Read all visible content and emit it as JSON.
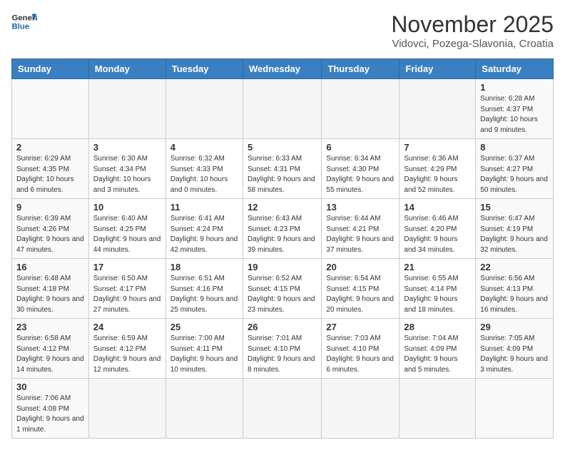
{
  "header": {
    "logo_general": "General",
    "logo_blue": "Blue",
    "month": "November 2025",
    "location": "Vidovci, Pozega-Slavonia, Croatia"
  },
  "days_of_week": [
    "Sunday",
    "Monday",
    "Tuesday",
    "Wednesday",
    "Thursday",
    "Friday",
    "Saturday"
  ],
  "weeks": [
    [
      {
        "day": "",
        "info": ""
      },
      {
        "day": "",
        "info": ""
      },
      {
        "day": "",
        "info": ""
      },
      {
        "day": "",
        "info": ""
      },
      {
        "day": "",
        "info": ""
      },
      {
        "day": "",
        "info": ""
      },
      {
        "day": "1",
        "info": "Sunrise: 6:28 AM\nSunset: 4:37 PM\nDaylight: 10 hours and 9 minutes."
      }
    ],
    [
      {
        "day": "2",
        "info": "Sunrise: 6:29 AM\nSunset: 4:35 PM\nDaylight: 10 hours and 6 minutes."
      },
      {
        "day": "3",
        "info": "Sunrise: 6:30 AM\nSunset: 4:34 PM\nDaylight: 10 hours and 3 minutes."
      },
      {
        "day": "4",
        "info": "Sunrise: 6:32 AM\nSunset: 4:33 PM\nDaylight: 10 hours and 0 minutes."
      },
      {
        "day": "5",
        "info": "Sunrise: 6:33 AM\nSunset: 4:31 PM\nDaylight: 9 hours and 58 minutes."
      },
      {
        "day": "6",
        "info": "Sunrise: 6:34 AM\nSunset: 4:30 PM\nDaylight: 9 hours and 55 minutes."
      },
      {
        "day": "7",
        "info": "Sunrise: 6:36 AM\nSunset: 4:29 PM\nDaylight: 9 hours and 52 minutes."
      },
      {
        "day": "8",
        "info": "Sunrise: 6:37 AM\nSunset: 4:27 PM\nDaylight: 9 hours and 50 minutes."
      }
    ],
    [
      {
        "day": "9",
        "info": "Sunrise: 6:39 AM\nSunset: 4:26 PM\nDaylight: 9 hours and 47 minutes."
      },
      {
        "day": "10",
        "info": "Sunrise: 6:40 AM\nSunset: 4:25 PM\nDaylight: 9 hours and 44 minutes."
      },
      {
        "day": "11",
        "info": "Sunrise: 6:41 AM\nSunset: 4:24 PM\nDaylight: 9 hours and 42 minutes."
      },
      {
        "day": "12",
        "info": "Sunrise: 6:43 AM\nSunset: 4:23 PM\nDaylight: 9 hours and 39 minutes."
      },
      {
        "day": "13",
        "info": "Sunrise: 6:44 AM\nSunset: 4:21 PM\nDaylight: 9 hours and 37 minutes."
      },
      {
        "day": "14",
        "info": "Sunrise: 6:46 AM\nSunset: 4:20 PM\nDaylight: 9 hours and 34 minutes."
      },
      {
        "day": "15",
        "info": "Sunrise: 6:47 AM\nSunset: 4:19 PM\nDaylight: 9 hours and 32 minutes."
      }
    ],
    [
      {
        "day": "16",
        "info": "Sunrise: 6:48 AM\nSunset: 4:18 PM\nDaylight: 9 hours and 30 minutes."
      },
      {
        "day": "17",
        "info": "Sunrise: 6:50 AM\nSunset: 4:17 PM\nDaylight: 9 hours and 27 minutes."
      },
      {
        "day": "18",
        "info": "Sunrise: 6:51 AM\nSunset: 4:16 PM\nDaylight: 9 hours and 25 minutes."
      },
      {
        "day": "19",
        "info": "Sunrise: 6:52 AM\nSunset: 4:15 PM\nDaylight: 9 hours and 23 minutes."
      },
      {
        "day": "20",
        "info": "Sunrise: 6:54 AM\nSunset: 4:15 PM\nDaylight: 9 hours and 20 minutes."
      },
      {
        "day": "21",
        "info": "Sunrise: 6:55 AM\nSunset: 4:14 PM\nDaylight: 9 hours and 18 minutes."
      },
      {
        "day": "22",
        "info": "Sunrise: 6:56 AM\nSunset: 4:13 PM\nDaylight: 9 hours and 16 minutes."
      }
    ],
    [
      {
        "day": "23",
        "info": "Sunrise: 6:58 AM\nSunset: 4:12 PM\nDaylight: 9 hours and 14 minutes."
      },
      {
        "day": "24",
        "info": "Sunrise: 6:59 AM\nSunset: 4:12 PM\nDaylight: 9 hours and 12 minutes."
      },
      {
        "day": "25",
        "info": "Sunrise: 7:00 AM\nSunset: 4:11 PM\nDaylight: 9 hours and 10 minutes."
      },
      {
        "day": "26",
        "info": "Sunrise: 7:01 AM\nSunset: 4:10 PM\nDaylight: 9 hours and 8 minutes."
      },
      {
        "day": "27",
        "info": "Sunrise: 7:03 AM\nSunset: 4:10 PM\nDaylight: 9 hours and 6 minutes."
      },
      {
        "day": "28",
        "info": "Sunrise: 7:04 AM\nSunset: 4:09 PM\nDaylight: 9 hours and 5 minutes."
      },
      {
        "day": "29",
        "info": "Sunrise: 7:05 AM\nSunset: 4:09 PM\nDaylight: 9 hours and 3 minutes."
      }
    ],
    [
      {
        "day": "30",
        "info": "Sunrise: 7:06 AM\nSunset: 4:08 PM\nDaylight: 9 hours and 1 minute."
      },
      {
        "day": "",
        "info": ""
      },
      {
        "day": "",
        "info": ""
      },
      {
        "day": "",
        "info": ""
      },
      {
        "day": "",
        "info": ""
      },
      {
        "day": "",
        "info": ""
      },
      {
        "day": "",
        "info": ""
      }
    ]
  ]
}
